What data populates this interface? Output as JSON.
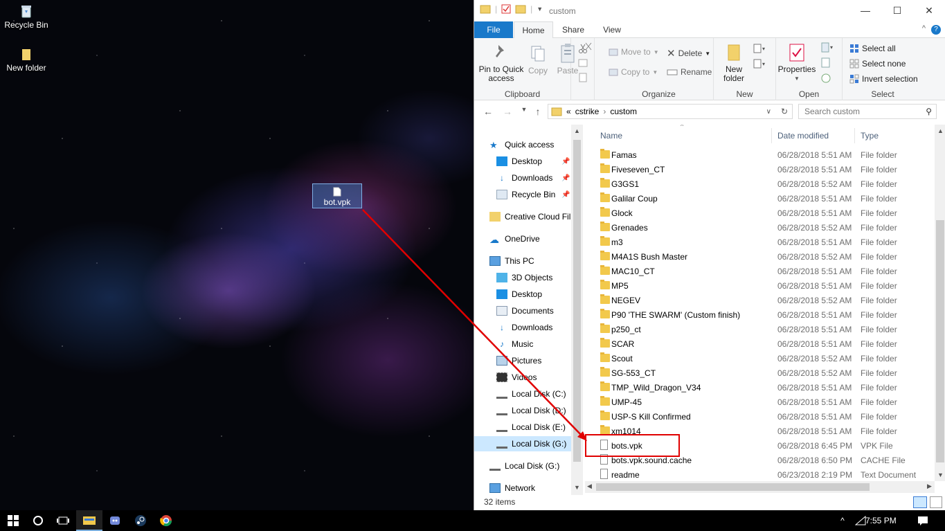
{
  "desktop": {
    "icons": [
      {
        "label": "Recycle Bin"
      },
      {
        "label": "New folder"
      }
    ],
    "drag_item": {
      "label": "bot.vpk"
    }
  },
  "window": {
    "title": "custom",
    "controls": {
      "minimize": "—",
      "maximize": "☐",
      "close": "✕"
    }
  },
  "ribbon": {
    "tabs": [
      "File",
      "Home",
      "Share",
      "View"
    ],
    "clipboard": {
      "pin": "Pin to Quick access",
      "copy": "Copy",
      "paste": "Paste",
      "label": "Clipboard"
    },
    "organize": {
      "move_to": "Move to",
      "copy_to": "Copy to",
      "delete": "Delete",
      "rename": "Rename",
      "label": "Organize"
    },
    "new": {
      "new_folder": "New folder",
      "label": "New"
    },
    "open": {
      "properties": "Properties",
      "label": "Open"
    },
    "select": {
      "select_all": "Select all",
      "select_none": "Select none",
      "invert": "Invert selection",
      "label": "Select"
    }
  },
  "address": {
    "overflow": "«",
    "crumbs": [
      "cstrike",
      "custom"
    ],
    "search_placeholder": "Search custom"
  },
  "nav": {
    "quick_access": "Quick access",
    "qa_items": [
      "Desktop",
      "Downloads",
      "Recycle Bin"
    ],
    "creative_cloud": "Creative Cloud Fil",
    "onedrive": "OneDrive",
    "this_pc": "This PC",
    "pc_items": [
      "3D Objects",
      "Desktop",
      "Documents",
      "Downloads",
      "Music",
      "Pictures",
      "Videos",
      "Local Disk (C:)",
      "Local Disk (D:)",
      "Local Disk (E:)",
      "Local Disk (G:)"
    ],
    "local_g": "Local Disk (G:)",
    "network": "Network"
  },
  "columns": {
    "name": "Name",
    "date": "Date modified",
    "type": "Type"
  },
  "files": [
    {
      "name": "Famas",
      "date": "06/28/2018 5:51 AM",
      "type": "File folder",
      "kind": "folder"
    },
    {
      "name": "Fiveseven_CT",
      "date": "06/28/2018 5:51 AM",
      "type": "File folder",
      "kind": "folder"
    },
    {
      "name": "G3GS1",
      "date": "06/28/2018 5:52 AM",
      "type": "File folder",
      "kind": "folder"
    },
    {
      "name": "Galilar  Coup",
      "date": "06/28/2018 5:51 AM",
      "type": "File folder",
      "kind": "folder"
    },
    {
      "name": "Glock",
      "date": "06/28/2018 5:51 AM",
      "type": "File folder",
      "kind": "folder"
    },
    {
      "name": "Grenades",
      "date": "06/28/2018 5:52 AM",
      "type": "File folder",
      "kind": "folder"
    },
    {
      "name": "m3",
      "date": "06/28/2018 5:51 AM",
      "type": "File folder",
      "kind": "folder"
    },
    {
      "name": "M4A1S Bush Master",
      "date": "06/28/2018 5:52 AM",
      "type": "File folder",
      "kind": "folder"
    },
    {
      "name": "MAC10_CT",
      "date": "06/28/2018 5:51 AM",
      "type": "File folder",
      "kind": "folder"
    },
    {
      "name": "MP5",
      "date": "06/28/2018 5:51 AM",
      "type": "File folder",
      "kind": "folder"
    },
    {
      "name": "NEGEV",
      "date": "06/28/2018 5:52 AM",
      "type": "File folder",
      "kind": "folder"
    },
    {
      "name": "P90  'THE SWARM' (Custom finish)",
      "date": "06/28/2018 5:51 AM",
      "type": "File folder",
      "kind": "folder"
    },
    {
      "name": "p250_ct",
      "date": "06/28/2018 5:51 AM",
      "type": "File folder",
      "kind": "folder"
    },
    {
      "name": "SCAR",
      "date": "06/28/2018 5:51 AM",
      "type": "File folder",
      "kind": "folder"
    },
    {
      "name": "Scout",
      "date": "06/28/2018 5:52 AM",
      "type": "File folder",
      "kind": "folder"
    },
    {
      "name": "SG-553_CT",
      "date": "06/28/2018 5:52 AM",
      "type": "File folder",
      "kind": "folder"
    },
    {
      "name": "TMP_Wild_Dragon_V34",
      "date": "06/28/2018 5:51 AM",
      "type": "File folder",
      "kind": "folder"
    },
    {
      "name": "UMP-45",
      "date": "06/28/2018 5:51 AM",
      "type": "File folder",
      "kind": "folder"
    },
    {
      "name": "USP-S Kill Confirmed",
      "date": "06/28/2018 5:51 AM",
      "type": "File folder",
      "kind": "folder"
    },
    {
      "name": "xm1014",
      "date": "06/28/2018 5:51 AM",
      "type": "File folder",
      "kind": "folder"
    },
    {
      "name": "bots.vpk",
      "date": "06/28/2018 6:45 PM",
      "type": "VPK File",
      "kind": "file"
    },
    {
      "name": "bots.vpk.sound.cache",
      "date": "06/28/2018 6:50 PM",
      "type": "CACHE File",
      "kind": "file"
    },
    {
      "name": "readme",
      "date": "06/23/2018 2:19 PM",
      "type": "Text Document",
      "kind": "file"
    }
  ],
  "status": {
    "count": "32 items"
  },
  "taskbar": {
    "time": "7:55 PM"
  },
  "colors": {
    "accent": "#1979ca",
    "annotation": "#e00000",
    "folder": "#f2c94c"
  }
}
